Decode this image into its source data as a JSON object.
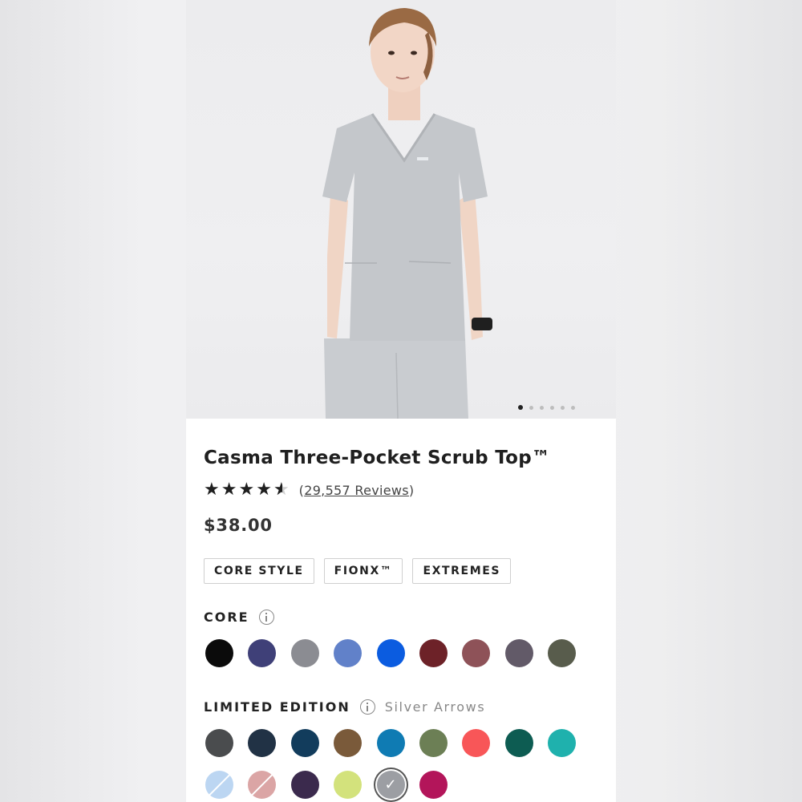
{
  "product": {
    "title": "Casma Three-Pocket Scrub Top™",
    "rating": 4.5,
    "reviews_label": "29,557 Reviews",
    "reviews_open": "(",
    "reviews_close": ")",
    "price": "$38.00"
  },
  "gallery": {
    "image_alt": "Model wearing light grey Casma scrub top",
    "slide_count": 6,
    "active_slide": 1
  },
  "styles": [
    {
      "label": "CORE STYLE"
    },
    {
      "label": "FIONX™"
    },
    {
      "label": "EXTREMES"
    }
  ],
  "core": {
    "label": "CORE",
    "colors": [
      "#0b0b0b",
      "#3f4078",
      "#8b8c92",
      "#6181c9",
      "#0b5ce0",
      "#6d2228",
      "#8e5258",
      "#625a68",
      "#585c4c"
    ]
  },
  "limited": {
    "label": "LIMITED EDITION",
    "selected_name": "Silver Arrows",
    "colors_row1": [
      "#4a4c4e",
      "#213245",
      "#123c5c",
      "#7a5a3a",
      "#0f7bb3",
      "#6c7f55",
      "#f85658",
      "#0d5c52",
      "#1fb1ad"
    ],
    "colors_row2": [
      "#bcd6f2",
      "#dba5a5",
      "#3b2a4d",
      "#d3e27c",
      "#9c9ea3",
      "#b3155a"
    ],
    "row2_stripes": [
      true,
      true,
      false,
      false,
      false,
      false
    ],
    "selected_index_row2": 4
  },
  "icons": {
    "star": "star-icon",
    "info": "info-icon",
    "check": "check-icon"
  }
}
